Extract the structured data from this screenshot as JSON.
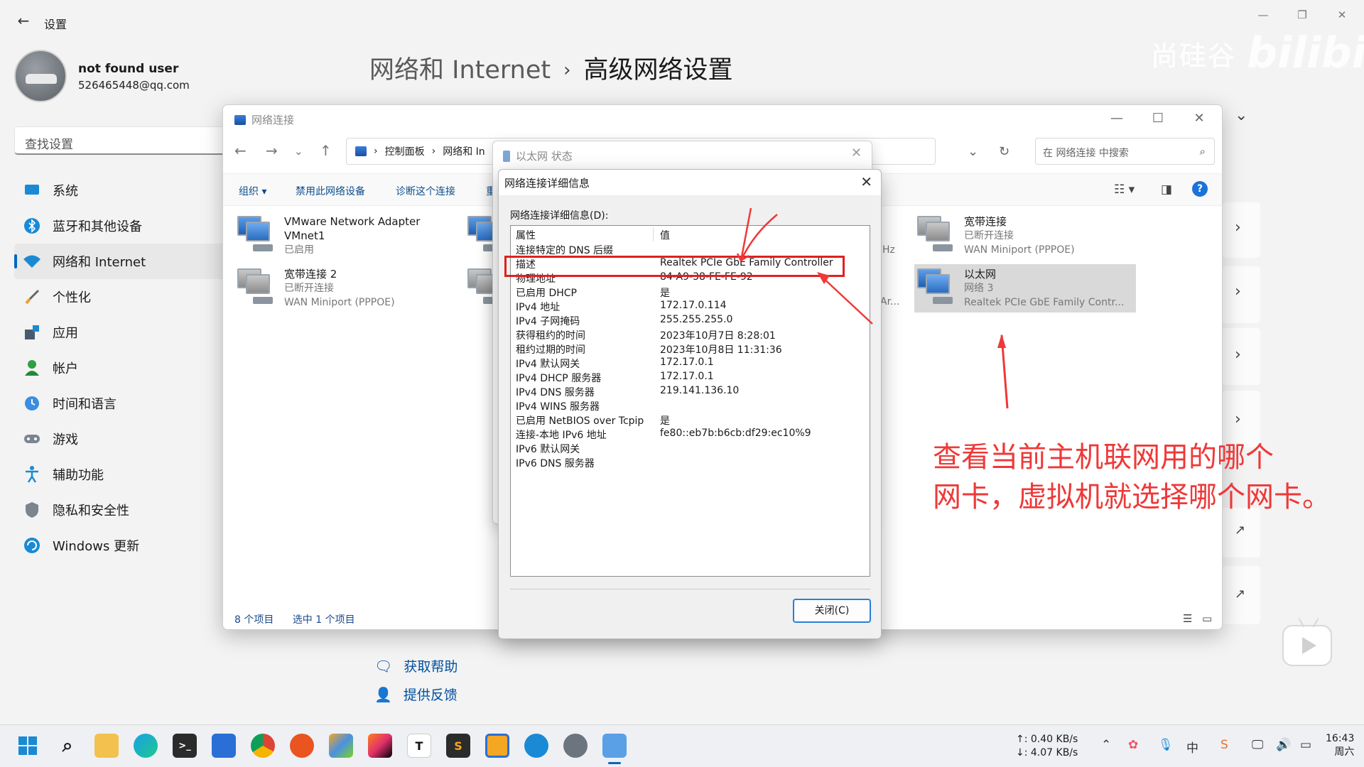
{
  "settings": {
    "app_title": "设置",
    "user_name": "not found user",
    "user_email": "526465448@qq.com",
    "search_placeholder": "查找设置",
    "breadcrumb_parent": "网络和 Internet",
    "breadcrumb_sep": "›",
    "breadcrumb_current": "高级网络设置",
    "nav": [
      {
        "label": "系统",
        "icon": "system-icon"
      },
      {
        "label": "蓝牙和其他设备",
        "icon": "bluetooth-icon"
      },
      {
        "label": "网络和 Internet",
        "icon": "wifi-icon",
        "active": true
      },
      {
        "label": "个性化",
        "icon": "brush-icon"
      },
      {
        "label": "应用",
        "icon": "apps-icon"
      },
      {
        "label": "帐户",
        "icon": "account-icon"
      },
      {
        "label": "时间和语言",
        "icon": "clock-globe-icon"
      },
      {
        "label": "游戏",
        "icon": "gamepad-icon"
      },
      {
        "label": "辅助功能",
        "icon": "accessibility-icon"
      },
      {
        "label": "隐私和安全性",
        "icon": "shield-icon"
      },
      {
        "label": "Windows 更新",
        "icon": "update-icon"
      }
    ],
    "help_link": "获取帮助",
    "feedback_link": "提供反馈",
    "watermark_text": "尚硅谷",
    "watermark_logo": "bilibili"
  },
  "explorer": {
    "title": "网络连接",
    "address": {
      "seg1": "控制面板",
      "seg2": "网络和 In"
    },
    "search_placeholder": "在 网络连接 中搜索",
    "commands": [
      "组织 ▾",
      "禁用此网络设备",
      "诊断这个连接",
      "重"
    ],
    "connections": [
      {
        "name": "VMware Network Adapter VMnet1",
        "status": "已启用",
        "device": ""
      },
      {
        "name": "宽带连接 2",
        "status": "已断开连接",
        "device": "WAN Miniport (PPPOE)"
      },
      {
        "name": "宽带连接",
        "status": "已断开连接",
        "device": "WAN Miniport (PPPOE)"
      },
      {
        "name": "以太网",
        "status": "网络 3",
        "device": "Realtek PCIe GbE Family Contr..."
      }
    ],
    "partial_text": [
      "Hz",
      "Ar..."
    ],
    "status_count": "8 个项目",
    "status_selected": "选中 1 个项目"
  },
  "eth_status": {
    "title": "以太网 状态"
  },
  "details": {
    "title": "网络连接详细信息",
    "label": "网络连接详细信息(D):",
    "header": {
      "prop": "属性",
      "val": "值"
    },
    "rows": [
      {
        "prop": "连接特定的 DNS 后缀",
        "val": ""
      },
      {
        "prop": "描述",
        "val": "Realtek PCIe GbE Family Controller"
      },
      {
        "prop": "物理地址",
        "val": "84-A9-38-FE-FE-92"
      },
      {
        "prop": "已启用 DHCP",
        "val": "是"
      },
      {
        "prop": "IPv4 地址",
        "val": "172.17.0.114"
      },
      {
        "prop": "IPv4 子网掩码",
        "val": "255.255.255.0"
      },
      {
        "prop": "获得租约的时间",
        "val": "2023年10月7日 8:28:01"
      },
      {
        "prop": "租约过期的时间",
        "val": "2023年10月8日 11:31:36"
      },
      {
        "prop": "IPv4 默认网关",
        "val": "172.17.0.1"
      },
      {
        "prop": "IPv4 DHCP 服务器",
        "val": "172.17.0.1"
      },
      {
        "prop": "IPv4 DNS 服务器",
        "val": "219.141.136.10"
      },
      {
        "prop": "IPv4 WINS 服务器",
        "val": ""
      },
      {
        "prop": "已启用 NetBIOS over Tcpip",
        "val": "是"
      },
      {
        "prop": "连接-本地 IPv6 地址",
        "val": "fe80::eb7b:b6cb:df29:ec10%9"
      },
      {
        "prop": "IPv6 默认网关",
        "val": ""
      },
      {
        "prop": "IPv6 DNS 服务器",
        "val": ""
      }
    ],
    "close_button": "关闭(C)"
  },
  "annotation": {
    "line1": "查看当前主机联网用的哪个",
    "line2": "网卡，虚拟机就选择哪个网卡。",
    "color": "#ef3838"
  },
  "taskbar": {
    "upload_speed": "↑: 0.40 KB/s",
    "download_speed": "↓: 4.07 KB/s",
    "time": "16:43",
    "weekday": "周六"
  }
}
